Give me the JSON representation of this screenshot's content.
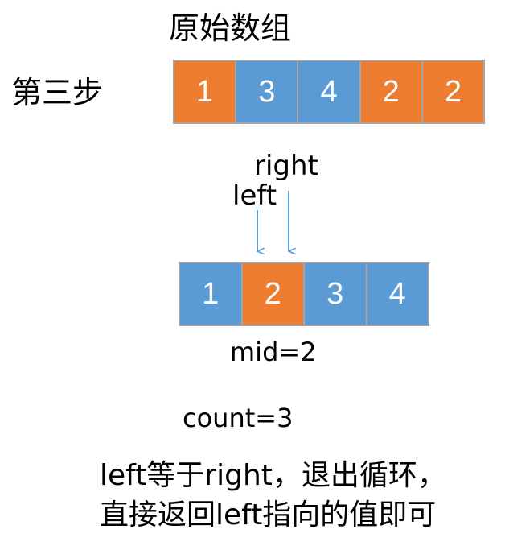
{
  "title": "原始数组",
  "step_label": "第三步",
  "colors": {
    "orange": "#ED7D31",
    "blue": "#5B9BD5",
    "border": "#A6A6A6",
    "arrow": "#5B9BD5"
  },
  "original_array": [
    {
      "value": "1",
      "color": "orange"
    },
    {
      "value": "3",
      "color": "blue"
    },
    {
      "value": "4",
      "color": "blue"
    },
    {
      "value": "2",
      "color": "orange"
    },
    {
      "value": "2",
      "color": "orange"
    }
  ],
  "sorted_array": [
    {
      "value": "1",
      "color": "blue"
    },
    {
      "value": "2",
      "color": "orange"
    },
    {
      "value": "3",
      "color": "blue"
    },
    {
      "value": "4",
      "color": "blue"
    }
  ],
  "pointers": {
    "right": "right",
    "left": "left"
  },
  "mid_label": "mid=2",
  "count_label": "count=3",
  "conclusion": {
    "line1": "left等于right，退出循环，",
    "line2": "直接返回left指向的值即可"
  }
}
